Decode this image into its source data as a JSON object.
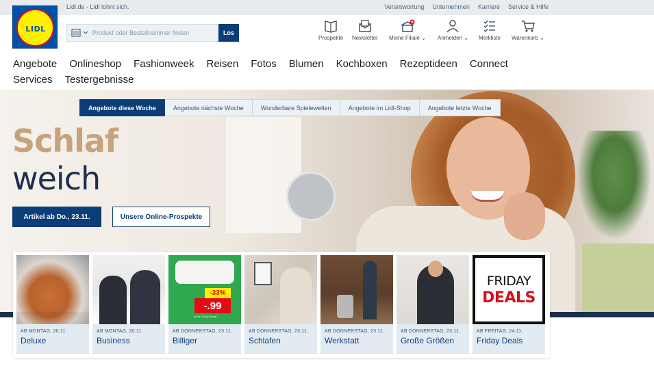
{
  "topbar": {
    "slogan": "Lidl.de - Lidl lohnt sich.",
    "links": [
      "Verantwortung",
      "Unternehmen",
      "Karriere",
      "Service & Hilfe"
    ]
  },
  "logo": {
    "text": "LIDL"
  },
  "search": {
    "placeholder": "Produkt oder Bestellnummer finden",
    "button_label": "Los"
  },
  "header_icons": [
    {
      "label": "Prospekte",
      "icon": "brochure-icon"
    },
    {
      "label": "Newsletter",
      "icon": "newsletter-icon"
    },
    {
      "label": "Meine Filiale",
      "icon": "store-icon"
    },
    {
      "label": "Anmelden",
      "icon": "user-icon"
    },
    {
      "label": "Merkliste",
      "icon": "checklist-icon"
    },
    {
      "label": "Warenkorb",
      "icon": "cart-icon"
    }
  ],
  "nav": {
    "row1": [
      "Angebote",
      "Onlineshop",
      "Fashionweek",
      "Reisen",
      "Fotos",
      "Blumen",
      "Kochboxen",
      "Rezeptideen",
      "Connect"
    ],
    "row2": [
      "Services",
      "Testergebnisse"
    ]
  },
  "tabs": [
    {
      "label": "Angebote diese Woche",
      "active": true
    },
    {
      "label": "Angebote nächste Woche",
      "active": false
    },
    {
      "label": "Wunderbare Spielewelten",
      "active": false
    },
    {
      "label": "Angebote im Lidl-Shop",
      "active": false
    },
    {
      "label": "Angebote letzte Woche",
      "active": false
    }
  ],
  "hero": {
    "title_line1": "Schlaf",
    "title_line2": "weich",
    "cta_primary": "Artikel ab Do., 23.11.",
    "cta_secondary": "Unsere Online-Prospekte"
  },
  "tiles": [
    {
      "date": "AB MONTAG, 20.11.",
      "label": "Deluxe"
    },
    {
      "date": "AB MONTAG, 20.11.",
      "label": "Business"
    },
    {
      "date": "AB DONNERSTAG, 23.11.",
      "label": "Billiger",
      "badge_percent": "-33%",
      "badge_price": "-.99",
      "badge_small": "je 6x 100 g Packg."
    },
    {
      "date": "AB DONNERSTAG, 23.11.",
      "label": "Schlafen"
    },
    {
      "date": "AB DONNERSTAG, 23.11.",
      "label": "Werkstatt"
    },
    {
      "date": "AB DONNERSTAG, 23.11.",
      "label": "Große Größen"
    },
    {
      "date": "AB FREITAG, 24.11.",
      "label": "Friday Deals",
      "img_line1": "FRIDAY",
      "img_line2": "DEALS"
    }
  ],
  "colors": {
    "brand_blue": "#0050aa",
    "dark_blue": "#0b3d78",
    "yellow": "#fff000",
    "red": "#e60a14",
    "hero_beige": "#c7a37d"
  }
}
